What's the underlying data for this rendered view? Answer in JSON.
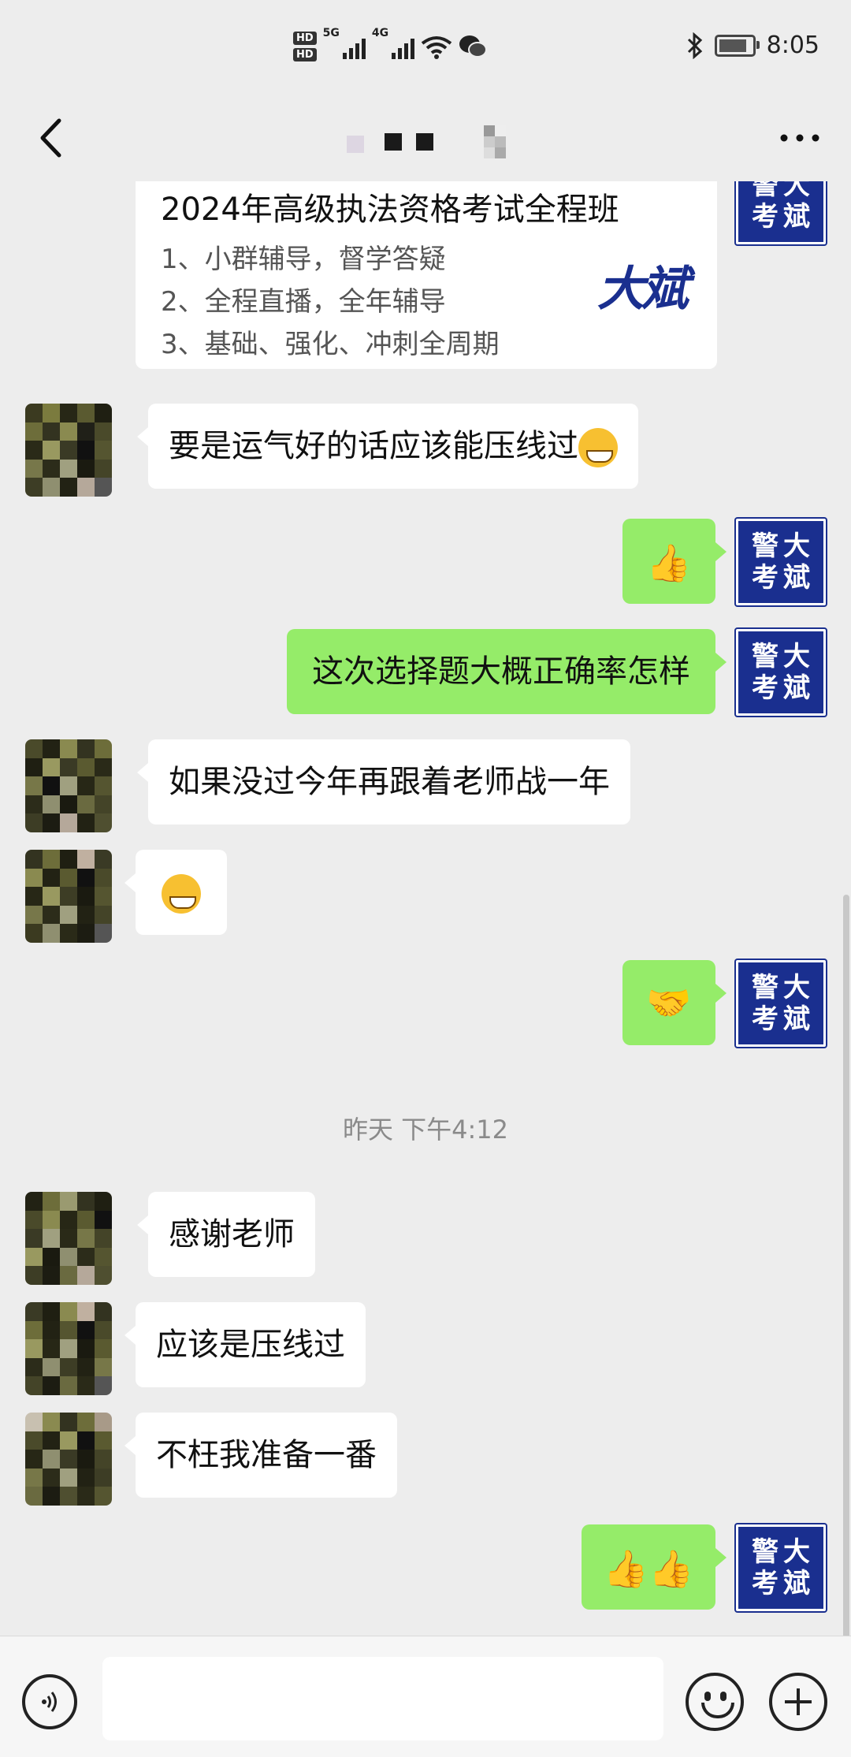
{
  "status_bar": {
    "time": "8:05",
    "network_1": "5G",
    "network_2": "4G",
    "hd_1": "HD",
    "hd_2": "HD",
    "bluetooth_icon": "bluetooth-icon",
    "wechat_icon": "wechat-icon"
  },
  "nav": {
    "back_icon": "chevron-left-icon",
    "more_icon": "more-dots-icon"
  },
  "brand": {
    "avatar_chars": [
      "警",
      "大",
      "考",
      "斌"
    ],
    "color": "#1a2f8f"
  },
  "card": {
    "title": "2024年高级执法资格考试全程班",
    "items": [
      "1、小群辅导，督学答疑",
      "2、全程直播，全年辅导",
      "3、基础、强化、冲刺全周期"
    ],
    "logo_text": "大斌"
  },
  "messages": [
    {
      "side": "left",
      "text": "要是运气好的话应该能压线过",
      "emoji": "grinning-face"
    },
    {
      "side": "right",
      "emoji": "thumbs-up"
    },
    {
      "side": "right",
      "text": "这次选择题大概正确率怎样"
    },
    {
      "side": "left",
      "text": "如果没过今年再跟着老师战一年"
    },
    {
      "side": "left",
      "emoji": "grinning-face"
    },
    {
      "side": "right",
      "emoji": "handshake"
    },
    {
      "side": "left",
      "text": "感谢老师"
    },
    {
      "side": "left",
      "text": "应该是压线过"
    },
    {
      "side": "left",
      "text": "不枉我准备一番"
    },
    {
      "side": "right",
      "emoji": "thumbs-up-x2"
    }
  ],
  "time_divider": "昨天 下午4:12",
  "input_bar": {
    "voice_icon": "voice-icon",
    "emoji_icon": "emoji-icon",
    "plus_icon": "plus-icon",
    "placeholder": ""
  },
  "colors": {
    "chat_bg": "#ededed",
    "bubble_self": "#95ec69",
    "bubble_other": "#ffffff"
  }
}
